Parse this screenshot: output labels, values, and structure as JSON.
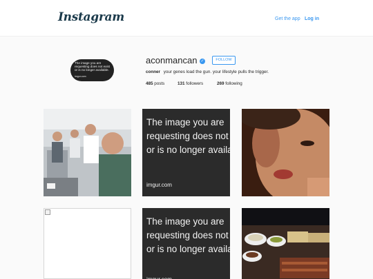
{
  "header": {
    "logo": "Instagram",
    "get_app": "Get the app",
    "log_in": "Log in"
  },
  "profile": {
    "avatar_lines": [
      "The image you are",
      "requesting does not exist",
      "or is no longer available."
    ],
    "avatar_footer": "imgur.com",
    "username": "aconmancan",
    "verified": "✓",
    "follow_label": "FOLLOW",
    "name": "conner",
    "bio": "your genes load the gun. your lifestyle pulls the trigger.",
    "stats": {
      "posts_count": "485",
      "posts_label": "posts",
      "followers_count": "131",
      "followers_label": "followers",
      "following_count": "269",
      "following_label": "following"
    }
  },
  "imgur_placeholder": {
    "lines": [
      "The image you are",
      "requesting does not exist",
      "or is no longer available."
    ],
    "footer": "imgur.com"
  },
  "colors": {
    "accent": "#3897f0",
    "background": "#fafafa",
    "placeholder_bg": "#2b2b2b"
  }
}
